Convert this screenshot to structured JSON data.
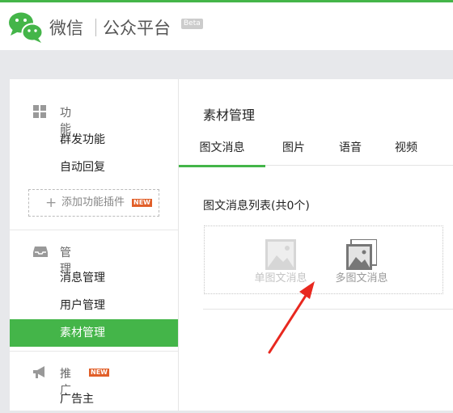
{
  "header": {
    "brand_wechat": "微信",
    "brand_platform": "公众平台",
    "beta": "Beta",
    "accent_color": "#44b549"
  },
  "sidebar": {
    "sections": [
      {
        "icon": "grid-icon",
        "title": "功能",
        "items": [
          "群发功能",
          "自动回复"
        ],
        "plugin_button": "添加功能插件",
        "plugin_badge": "NEW"
      },
      {
        "icon": "inbox-icon",
        "title": "管理",
        "items": [
          "消息管理",
          "用户管理",
          "素材管理"
        ],
        "active_item": "素材管理"
      },
      {
        "icon": "megaphone-icon",
        "title": "推广",
        "title_badge": "NEW",
        "items": [
          "广告主"
        ]
      }
    ]
  },
  "main": {
    "title": "素材管理",
    "tabs": [
      {
        "label": "图文消息",
        "active": true
      },
      {
        "label": "图片",
        "active": false
      },
      {
        "label": "语音",
        "active": false
      },
      {
        "label": "视频",
        "active": false
      }
    ],
    "list_title": "图文消息列表(共0个)",
    "actions": [
      {
        "label": "单图文消息",
        "icon": "single-image-icon"
      },
      {
        "label": "多图文消息",
        "icon": "multi-image-icon"
      }
    ]
  },
  "annotation": {
    "arrow_color": "#e8281f"
  }
}
